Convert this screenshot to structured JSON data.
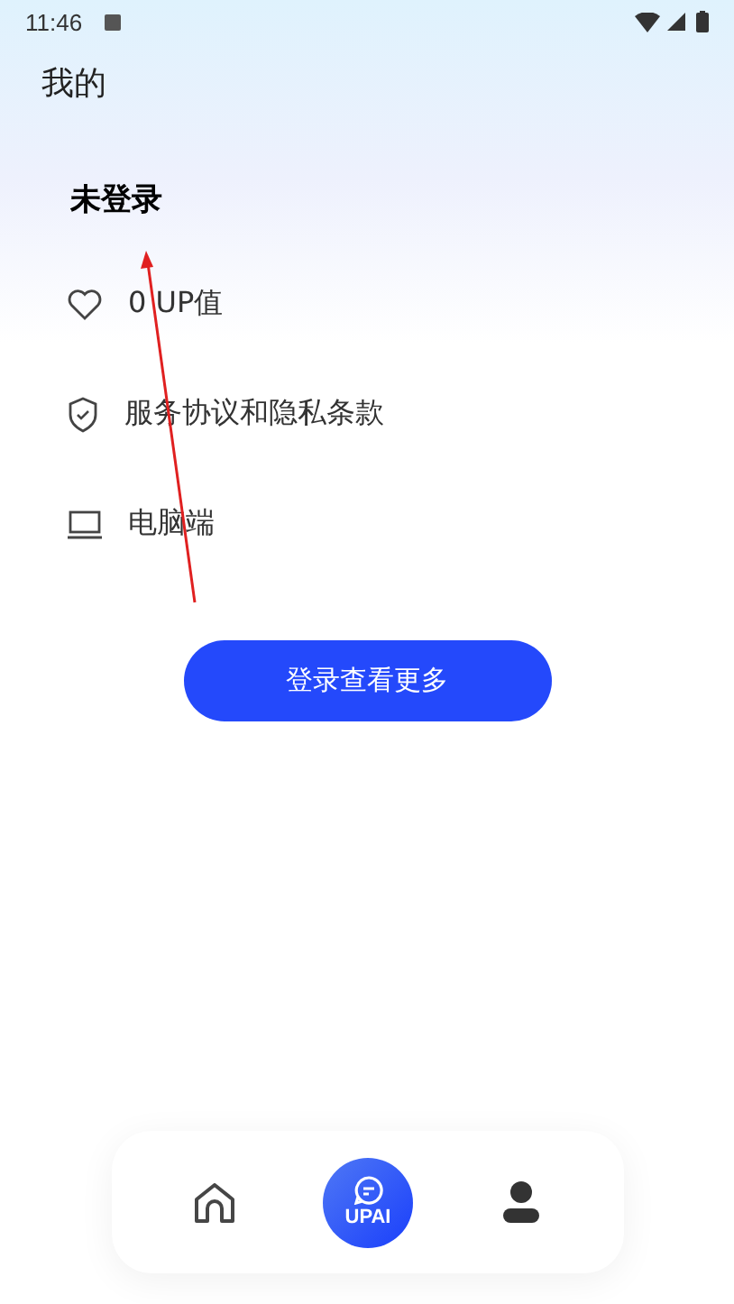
{
  "status_bar": {
    "time": "11:46"
  },
  "header": {
    "title": "我的"
  },
  "user": {
    "name": "未登录"
  },
  "menu": [
    {
      "kind": "points",
      "label": "0 UP值"
    },
    {
      "kind": "policy",
      "label": "服务协议和隐私条款"
    },
    {
      "kind": "desktop",
      "label": "电脑端"
    }
  ],
  "login_button": "登录查看更多",
  "tab_bar": [
    {
      "kind": "home",
      "selected": false
    },
    {
      "kind": "ai",
      "label": "UPAI",
      "selected": false
    },
    {
      "kind": "profile",
      "selected": true
    }
  ]
}
